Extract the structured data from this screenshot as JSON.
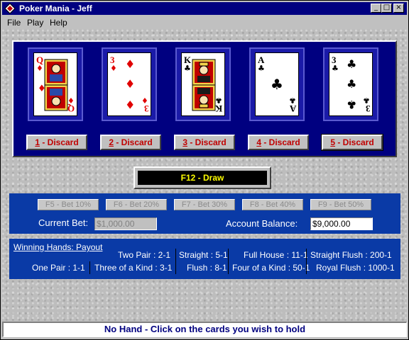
{
  "window": {
    "title": "Poker Mania - Jeff"
  },
  "menu": {
    "file": "File",
    "play": "Play",
    "help": "Help"
  },
  "cards": [
    {
      "rank": "Q",
      "suit": "diamonds",
      "symbol": "♦",
      "color": "red",
      "discard_label": "1 - Discard",
      "hotkey": "1",
      "label_rest": " - Discard"
    },
    {
      "rank": "3",
      "suit": "diamonds",
      "symbol": "♦",
      "color": "red",
      "discard_label": "2 - Discard",
      "hotkey": "2",
      "label_rest": " - Discard"
    },
    {
      "rank": "K",
      "suit": "clubs",
      "symbol": "♣",
      "color": "black",
      "discard_label": "3 - Discard",
      "hotkey": "3",
      "label_rest": " - Discard"
    },
    {
      "rank": "A",
      "suit": "clubs",
      "symbol": "♣",
      "color": "black",
      "discard_label": "4 - Discard",
      "hotkey": "4",
      "label_rest": " - Discard"
    },
    {
      "rank": "3",
      "suit": "clubs",
      "symbol": "♣",
      "color": "black",
      "discard_label": "5 - Discard",
      "hotkey": "5",
      "label_rest": " - Discard"
    }
  ],
  "draw_button": "F12 - Draw",
  "bet_buttons": [
    "F5 - Bet 10%",
    "F6 - Bet 20%",
    "F7 - Bet 30%",
    "F8 - Bet 40%",
    "F9 - Bet 50%"
  ],
  "current_bet": {
    "label": "Current Bet:",
    "value": "$1,000.00"
  },
  "account_balance": {
    "label": "Account Balance:",
    "value": "$9,000.00"
  },
  "payouts": {
    "title": "Winning Hands: Payout",
    "one_pair": "One Pair : 1-1",
    "two_pair": "Two Pair : 2-1",
    "three_kind": "Three of a Kind : 3-1",
    "straight": "Straight : 5-1",
    "flush": "Flush : 8-1",
    "full_house": "Full House : 11-1",
    "four_kind": "Four of a Kind : 50-1",
    "straight_flush": "Straight Flush : 200-1",
    "royal_flush": "Royal Flush : 1000-1"
  },
  "status": "No Hand  -  Click on the cards you wish to hold",
  "colors": {
    "title_bar": "#000080",
    "card_panel": "#000080",
    "bet_panel": "#0a3aa6",
    "discard_text": "#c00000",
    "draw_text": "#ffff00",
    "status_text": "#000080"
  }
}
